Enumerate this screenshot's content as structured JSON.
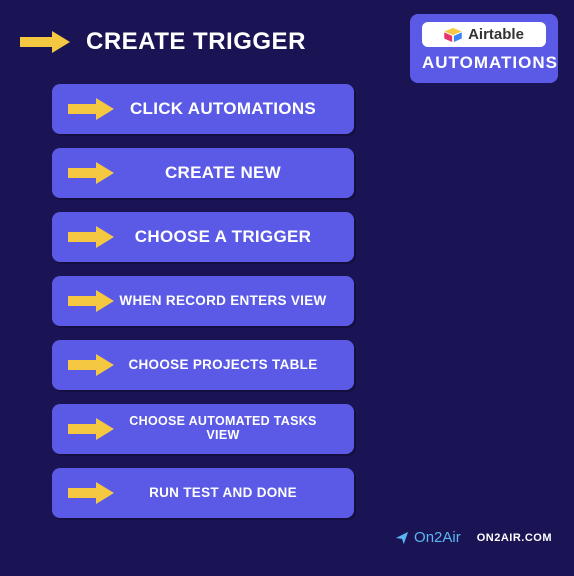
{
  "header": {
    "title": "Create Trigger"
  },
  "badge": {
    "brand": "Airtable",
    "sub": "AUTOMATIONS"
  },
  "steps": [
    {
      "label": "Click Automations",
      "size": "lg"
    },
    {
      "label": "Create New",
      "size": "lg"
    },
    {
      "label": "Choose a Trigger",
      "size": "lg"
    },
    {
      "label": "When Record Enters View",
      "size": "sm"
    },
    {
      "label": "Choose Projects Table",
      "size": "sm"
    },
    {
      "label": "Choose Automated Tasks View",
      "size": "xs"
    },
    {
      "label": "Run Test and Done",
      "size": "sm"
    }
  ],
  "footer": {
    "brand": "On2Air",
    "url": "on2air.com"
  }
}
